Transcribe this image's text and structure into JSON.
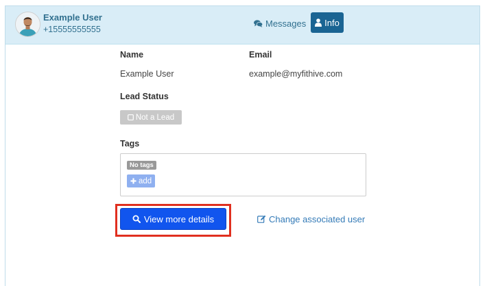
{
  "header": {
    "user_name": "Example User",
    "user_phone": "+15555555555",
    "tabs": [
      {
        "label": "Messages",
        "icon": "comments-icon",
        "active": false
      },
      {
        "label": "Info",
        "icon": "user-icon",
        "active": true
      }
    ]
  },
  "info": {
    "name_label": "Name",
    "name_value": "Example User",
    "email_label": "Email",
    "email_value": "example@myfithive.com",
    "lead_status_label": "Lead Status",
    "lead_status_button": "Not a Lead",
    "tags_label": "Tags",
    "no_tags": "No tags",
    "add_tag": "add"
  },
  "actions": {
    "view_more": "View more details",
    "change_user": "Change associated user"
  },
  "colors": {
    "header_bg": "#d9edf7",
    "accent_text": "#31708f",
    "active_tab": "#1a6493",
    "primary_button": "#1155ee",
    "highlight": "#e02f1f",
    "link": "#337ab7"
  }
}
